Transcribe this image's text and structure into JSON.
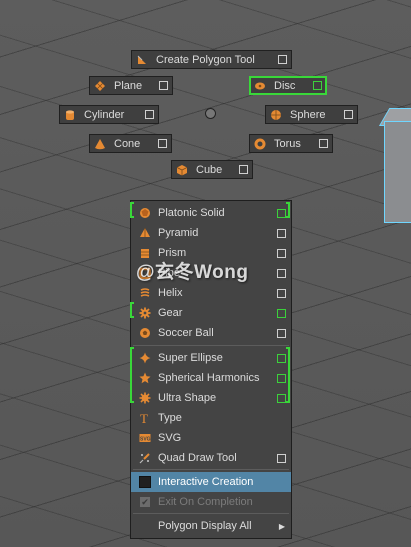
{
  "marking_menu": {
    "create_polygon_tool": "Create Polygon Tool",
    "plane": "Plane",
    "disc": "Disc",
    "cylinder": "Cylinder",
    "sphere": "Sphere",
    "cone": "Cone",
    "torus": "Torus",
    "cube": "Cube"
  },
  "menu": {
    "items": [
      {
        "label": "Platonic Solid",
        "icon": "platonic-solid-icon"
      },
      {
        "label": "Pyramid",
        "icon": "pyramid-icon"
      },
      {
        "label": "Prism",
        "icon": "prism-icon"
      },
      {
        "label": "Pipe",
        "icon": "pipe-icon"
      },
      {
        "label": "Helix",
        "icon": "helix-icon"
      },
      {
        "label": "Gear",
        "icon": "gear-icon"
      },
      {
        "label": "Soccer Ball",
        "icon": "soccer-ball-icon"
      },
      {
        "label": "Super Ellipse",
        "icon": "super-ellipse-icon"
      },
      {
        "label": "Spherical Harmonics",
        "icon": "spherical-harmonics-icon"
      },
      {
        "label": "Ultra Shape",
        "icon": "ultra-shape-icon"
      },
      {
        "label": "Type",
        "icon": "type-icon"
      },
      {
        "label": "SVG",
        "icon": "svg-icon"
      },
      {
        "label": "Quad Draw Tool",
        "icon": "quad-draw-icon"
      },
      {
        "label": "Interactive Creation"
      },
      {
        "label": "Exit On Completion"
      },
      {
        "label": "Polygon Display All"
      }
    ]
  },
  "watermark": "@玄冬Wong",
  "colors": {
    "icon_orange": "#e58a33",
    "highlight_green": "#39d839",
    "selection_blue": "#5285a6",
    "viewport_gray": "#5a5a5a"
  }
}
